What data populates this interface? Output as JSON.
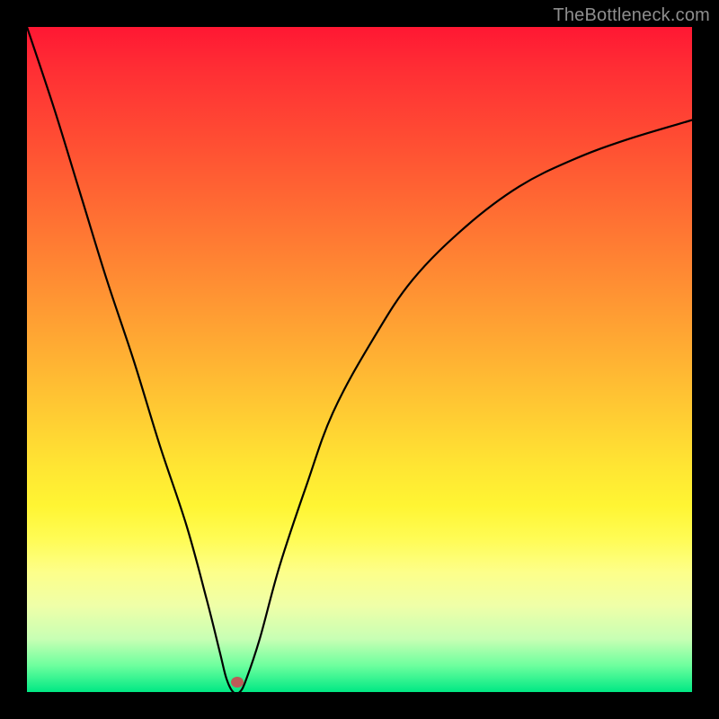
{
  "watermark": "TheBottleneck.com",
  "marker": {
    "x_frac": 0.316,
    "y_frac": 0.985,
    "color": "#bd5a58"
  },
  "chart_data": {
    "type": "line",
    "title": "",
    "xlabel": "",
    "ylabel": "",
    "xlim": [
      0,
      1
    ],
    "ylim": [
      0,
      1
    ],
    "x": [
      0.0,
      0.04,
      0.08,
      0.12,
      0.16,
      0.2,
      0.24,
      0.27,
      0.29,
      0.3,
      0.31,
      0.32,
      0.33,
      0.35,
      0.38,
      0.42,
      0.46,
      0.52,
      0.58,
      0.66,
      0.74,
      0.82,
      0.9,
      1.0
    ],
    "y": [
      1.0,
      0.88,
      0.75,
      0.62,
      0.5,
      0.37,
      0.25,
      0.14,
      0.06,
      0.02,
      0.0,
      0.0,
      0.02,
      0.08,
      0.19,
      0.31,
      0.42,
      0.53,
      0.62,
      0.7,
      0.76,
      0.8,
      0.83,
      0.86
    ],
    "notes": "Values are normalized fractions of the plot area (0 = left/bottom edge, 1 = right/top edge). The curve descends steeply from the top-left, reaches ~0 near x≈0.31, then rises with a concave shape toward the right, leveling near y≈0.86."
  }
}
